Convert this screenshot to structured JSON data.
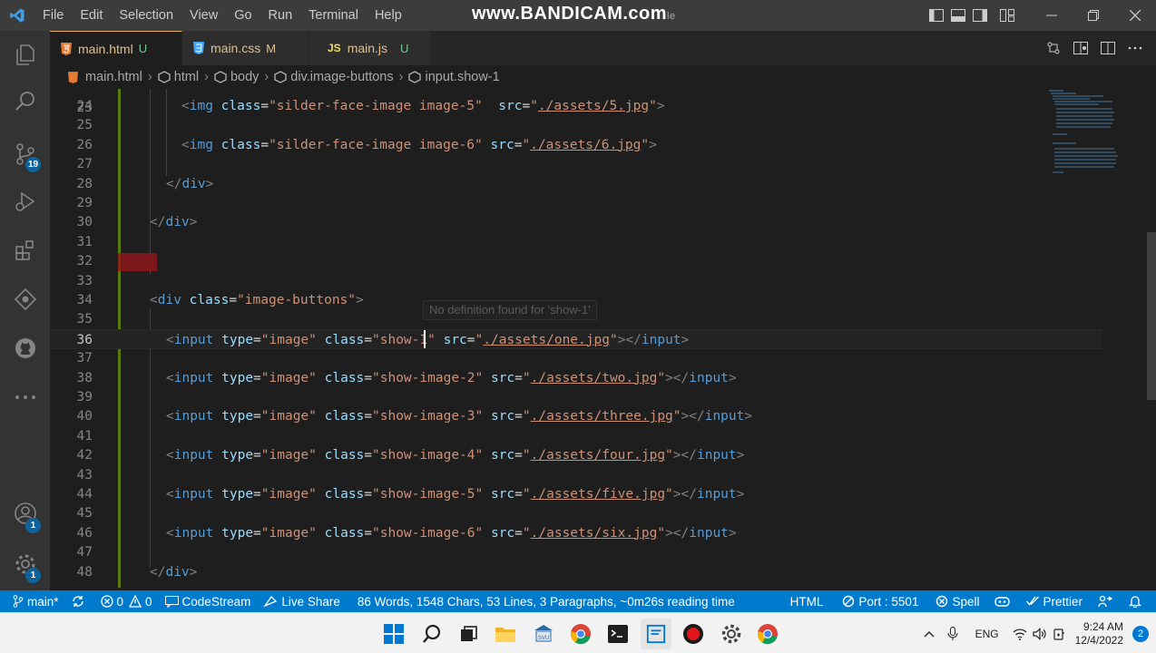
{
  "titlebar": {
    "menu": [
      "File",
      "Edit",
      "Selection",
      "View",
      "Go",
      "Run",
      "Terminal",
      "Help"
    ],
    "watermark": "www.BANDICAM.com",
    "watermark_suffix": "le"
  },
  "activity": {
    "scm_badge": "19",
    "accounts_badge": "1",
    "manage_badge": "1"
  },
  "tabs": [
    {
      "name": "main.html",
      "state": "U",
      "icon": "html5-icon",
      "color": "#e37933",
      "state_color": "#73c991",
      "active": true
    },
    {
      "name": "main.css",
      "state": "M",
      "icon": "css3-icon",
      "color": "#42a5f5",
      "state_color": "#e2c08d",
      "active": false
    },
    {
      "name": "main.js",
      "state": "U",
      "icon": "js-icon",
      "color": "#f1e05a",
      "state_color": "#73c991",
      "active": false
    }
  ],
  "breadcrumb": {
    "file": "main.html",
    "items": [
      "html",
      "body",
      "div.image-buttons",
      "input.show-1"
    ]
  },
  "editor": {
    "partial_top_number": "23",
    "partial_bottom_number": "49",
    "hover_text": "No definition found for 'show-1'",
    "current_line": "36",
    "lines": [
      {
        "n": "24",
        "tokens": [
          "<",
          "img",
          " ",
          "class",
          "=",
          "\"silder-face-image image-5\"",
          "  ",
          "src",
          "=",
          "\"",
          "./assets/5.jpg",
          "\"",
          ">"
        ]
      },
      {
        "n": "25",
        "tokens": []
      },
      {
        "n": "26",
        "tokens": [
          "<",
          "img",
          " ",
          "class",
          "=",
          "\"silder-face-image image-6\"",
          " ",
          "src",
          "=",
          "\"",
          "./assets/6.jpg",
          "\"",
          ">"
        ]
      },
      {
        "n": "27",
        "tokens": []
      },
      {
        "n": "28",
        "tokens": [
          "</",
          "div",
          ">"
        ]
      },
      {
        "n": "29",
        "tokens": []
      },
      {
        "n": "30",
        "tokens": [
          "</",
          "div",
          ">"
        ]
      },
      {
        "n": "31",
        "tokens": []
      },
      {
        "n": "32",
        "tokens": []
      },
      {
        "n": "33",
        "tokens": []
      },
      {
        "n": "34",
        "tokens": [
          "<",
          "div",
          " ",
          "class",
          "=",
          "\"image-buttons\"",
          ">"
        ]
      },
      {
        "n": "35",
        "tokens": []
      },
      {
        "n": "36",
        "tokens": [
          "<",
          "input",
          " ",
          "type",
          "=",
          "\"image\"",
          " ",
          "class",
          "=",
          "\"show-1\"",
          " ",
          "src",
          "=",
          "\"",
          "./assets/one.jpg",
          "\"",
          "></",
          "input",
          ">"
        ]
      },
      {
        "n": "37",
        "tokens": []
      },
      {
        "n": "38",
        "tokens": [
          "<",
          "input",
          " ",
          "type",
          "=",
          "\"image\"",
          " ",
          "class",
          "=",
          "\"show-image-2\"",
          " ",
          "src",
          "=",
          "\"",
          "./assets/two.jpg",
          "\"",
          "></",
          "input",
          ">"
        ]
      },
      {
        "n": "39",
        "tokens": []
      },
      {
        "n": "40",
        "tokens": [
          "<",
          "input",
          " ",
          "type",
          "=",
          "\"image\"",
          " ",
          "class",
          "=",
          "\"show-image-3\"",
          " ",
          "src",
          "=",
          "\"",
          "./assets/three.jpg",
          "\"",
          "></",
          "input",
          ">"
        ]
      },
      {
        "n": "41",
        "tokens": []
      },
      {
        "n": "42",
        "tokens": [
          "<",
          "input",
          " ",
          "type",
          "=",
          "\"image\"",
          " ",
          "class",
          "=",
          "\"show-image-4\"",
          " ",
          "src",
          "=",
          "\"",
          "./assets/four.jpg",
          "\"",
          "></",
          "input",
          ">"
        ]
      },
      {
        "n": "43",
        "tokens": []
      },
      {
        "n": "44",
        "tokens": [
          "<",
          "input",
          " ",
          "type",
          "=",
          "\"image\"",
          " ",
          "class",
          "=",
          "\"show-image-5\"",
          " ",
          "src",
          "=",
          "\"",
          "./assets/five.jpg",
          "\"",
          "></",
          "input",
          ">"
        ]
      },
      {
        "n": "45",
        "tokens": []
      },
      {
        "n": "46",
        "tokens": [
          "<",
          "input",
          " ",
          "type",
          "=",
          "\"image\"",
          " ",
          "class",
          "=",
          "\"show-image-6\"",
          " ",
          "src",
          "=",
          "\"",
          "./assets/six.jpg",
          "\"",
          "></",
          "input",
          ">"
        ]
      },
      {
        "n": "47",
        "tokens": []
      },
      {
        "n": "48",
        "tokens": [
          "</",
          "div",
          ">"
        ]
      }
    ]
  },
  "statusbar": {
    "branch": "main*",
    "errors": "0",
    "warnings": "0",
    "codestream": "CodeStream",
    "liveshare": "Live Share",
    "wordcount": "86 Words, 1548 Chars, 53 Lines, 3 Paragraphs, ~0m26s reading time",
    "language": "HTML",
    "port": "Port : 5501",
    "spell": "Spell",
    "prettier": "Prettier"
  },
  "taskbar": {
    "lang": "ENG",
    "time": "9:24 AM",
    "date": "12/4/2022",
    "notifications": "2"
  },
  "colors": {
    "accent": "#007acc",
    "editor_bg": "#1e1e1e",
    "tag": "#569cd6",
    "attr": "#9cdcfe",
    "string": "#ce9178",
    "added": "#587c0c",
    "deleted": "#94151b"
  }
}
